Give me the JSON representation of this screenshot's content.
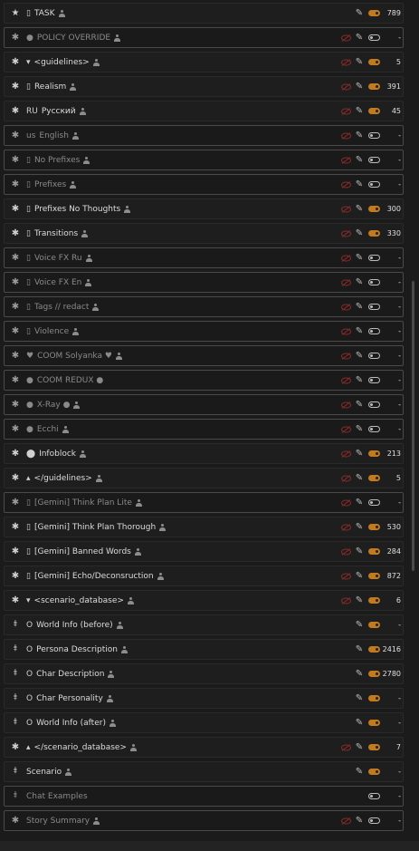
{
  "prompts": [
    {
      "icon": "star-pin",
      "glyph": "★",
      "label": "TASK",
      "prefix": "▯",
      "person": true,
      "noscan": false,
      "pencil": true,
      "toggle": "on",
      "tokens": "789",
      "disabled": false
    },
    {
      "icon": "asterisk",
      "glyph": "✱",
      "label": "POLICY OVERRIDE",
      "prefix": "●",
      "person": true,
      "noscan": true,
      "pencil": true,
      "toggle": "off",
      "tokens": "-",
      "disabled": true
    },
    {
      "icon": "asterisk",
      "glyph": "✱",
      "label": "<guidelines>",
      "prefix": "▾",
      "person": true,
      "noscan": true,
      "pencil": true,
      "toggle": "on",
      "tokens": "5",
      "disabled": false
    },
    {
      "icon": "asterisk",
      "glyph": "✱",
      "label": "Realism",
      "prefix": "▯",
      "person": true,
      "noscan": true,
      "pencil": true,
      "toggle": "on",
      "tokens": "391",
      "disabled": false
    },
    {
      "icon": "asterisk",
      "glyph": "✱",
      "label": "Русский",
      "prefix": "RU",
      "person": true,
      "noscan": true,
      "pencil": true,
      "toggle": "on",
      "tokens": "45",
      "disabled": false
    },
    {
      "icon": "asterisk",
      "glyph": "✱",
      "label": "English",
      "prefix": "us",
      "person": true,
      "noscan": true,
      "pencil": true,
      "toggle": "off",
      "tokens": "-",
      "disabled": true
    },
    {
      "icon": "asterisk",
      "glyph": "✱",
      "label": "No Prefixes",
      "prefix": "▯",
      "person": true,
      "noscan": true,
      "pencil": true,
      "toggle": "off",
      "tokens": "-",
      "disabled": true
    },
    {
      "icon": "asterisk",
      "glyph": "✱",
      "label": "Prefixes",
      "prefix": "▯",
      "person": true,
      "noscan": true,
      "pencil": true,
      "toggle": "off",
      "tokens": "-",
      "disabled": true
    },
    {
      "icon": "asterisk",
      "glyph": "✱",
      "label": "Prefixes No Thoughts",
      "prefix": "▯",
      "person": true,
      "noscan": true,
      "pencil": true,
      "toggle": "on",
      "tokens": "300",
      "disabled": false
    },
    {
      "icon": "asterisk",
      "glyph": "✱",
      "label": "Transitions",
      "prefix": "▯",
      "person": true,
      "noscan": true,
      "pencil": true,
      "toggle": "on",
      "tokens": "330",
      "disabled": false
    },
    {
      "icon": "asterisk",
      "glyph": "✱",
      "label": "Voice FX Ru",
      "prefix": "▯",
      "person": true,
      "noscan": true,
      "pencil": true,
      "toggle": "off",
      "tokens": "-",
      "disabled": true
    },
    {
      "icon": "asterisk",
      "glyph": "✱",
      "label": "Voice FX En",
      "prefix": "▯",
      "person": true,
      "noscan": true,
      "pencil": true,
      "toggle": "off",
      "tokens": "-",
      "disabled": true
    },
    {
      "icon": "asterisk",
      "glyph": "✱",
      "label": "Tags // redact",
      "prefix": "▯",
      "person": true,
      "noscan": true,
      "pencil": true,
      "toggle": "off",
      "tokens": "-",
      "disabled": true
    },
    {
      "icon": "asterisk",
      "glyph": "✱",
      "label": "Violence",
      "prefix": "▯",
      "person": true,
      "noscan": true,
      "pencil": true,
      "toggle": "off",
      "tokens": "-",
      "disabled": true
    },
    {
      "icon": "asterisk",
      "glyph": "✱",
      "label": "COOM Solyanka ♥",
      "prefix": "♥",
      "person": true,
      "noscan": true,
      "pencil": true,
      "toggle": "off",
      "tokens": "-",
      "disabled": true
    },
    {
      "icon": "asterisk",
      "glyph": "✱",
      "label": "COOM REDUX ●",
      "prefix": "●",
      "person": false,
      "noscan": true,
      "pencil": true,
      "toggle": "off",
      "tokens": "-",
      "disabled": true
    },
    {
      "icon": "asterisk",
      "glyph": "✱",
      "label": "X-Ray ●",
      "prefix": "●",
      "person": true,
      "noscan": true,
      "pencil": true,
      "toggle": "off",
      "tokens": "-",
      "disabled": true
    },
    {
      "icon": "asterisk",
      "glyph": "✱",
      "label": "Ecchi",
      "prefix": "●",
      "person": true,
      "noscan": true,
      "pencil": true,
      "toggle": "off",
      "tokens": "-",
      "disabled": true
    },
    {
      "icon": "asterisk",
      "glyph": "✱",
      "label": "Infoblock",
      "prefix": "⬤",
      "person": true,
      "noscan": true,
      "pencil": true,
      "toggle": "on",
      "tokens": "213",
      "disabled": false
    },
    {
      "icon": "asterisk",
      "glyph": "✱",
      "label": "</guidelines>",
      "prefix": "▴",
      "person": true,
      "noscan": true,
      "pencil": true,
      "toggle": "on",
      "tokens": "5",
      "disabled": false
    },
    {
      "icon": "asterisk",
      "glyph": "✱",
      "label": "[Gemini] Think Plan Lite",
      "prefix": "▯",
      "person": true,
      "noscan": true,
      "pencil": true,
      "toggle": "off",
      "tokens": "-",
      "disabled": true
    },
    {
      "icon": "asterisk",
      "glyph": "✱",
      "label": "[Gemini] Think Plan Thorough",
      "prefix": "▯",
      "person": true,
      "noscan": true,
      "pencil": true,
      "toggle": "on",
      "tokens": "530",
      "disabled": false
    },
    {
      "icon": "asterisk",
      "glyph": "✱",
      "label": "[Gemini] Banned Words",
      "prefix": "▯",
      "person": true,
      "noscan": true,
      "pencil": true,
      "toggle": "on",
      "tokens": "284",
      "disabled": false
    },
    {
      "icon": "asterisk",
      "glyph": "✱",
      "label": "[Gemini] Echo/Deconsruction",
      "prefix": "▯",
      "person": true,
      "noscan": true,
      "pencil": true,
      "toggle": "on",
      "tokens": "872",
      "disabled": false
    },
    {
      "icon": "asterisk",
      "glyph": "✱",
      "label": "<scenario_database>",
      "prefix": "▾",
      "person": true,
      "noscan": true,
      "pencil": true,
      "toggle": "on",
      "tokens": "6",
      "disabled": false
    },
    {
      "icon": "pin",
      "glyph": "⯒",
      "label": "World Info (before)",
      "prefix": "O",
      "person": true,
      "noscan": false,
      "pencil": true,
      "toggle": "on",
      "tokens": "-",
      "disabled": false
    },
    {
      "icon": "pin",
      "glyph": "⯒",
      "label": "Persona Description",
      "prefix": "O",
      "person": true,
      "noscan": false,
      "pencil": true,
      "toggle": "on",
      "tokens": "2416",
      "disabled": false
    },
    {
      "icon": "pin",
      "glyph": "⯒",
      "label": "Char Description",
      "prefix": "O",
      "person": true,
      "noscan": false,
      "pencil": true,
      "toggle": "on",
      "tokens": "2780",
      "disabled": false
    },
    {
      "icon": "pin",
      "glyph": "⯒",
      "label": "Char Personality",
      "prefix": "O",
      "person": true,
      "noscan": false,
      "pencil": true,
      "toggle": "on",
      "tokens": "-",
      "disabled": false
    },
    {
      "icon": "pin",
      "glyph": "⯒",
      "label": "World Info (after)",
      "prefix": "O",
      "person": true,
      "noscan": false,
      "pencil": true,
      "toggle": "on",
      "tokens": "-",
      "disabled": false
    },
    {
      "icon": "asterisk",
      "glyph": "✱",
      "label": "</scenario_database>",
      "prefix": "▴",
      "person": true,
      "noscan": true,
      "pencil": true,
      "toggle": "on",
      "tokens": "7",
      "disabled": false
    },
    {
      "icon": "pin",
      "glyph": "⯒",
      "label": "Scenario",
      "prefix": "",
      "person": true,
      "noscan": false,
      "pencil": true,
      "toggle": "on",
      "tokens": "-",
      "disabled": false
    },
    {
      "icon": "pin",
      "glyph": "⯒",
      "label": "Chat Examples",
      "prefix": "",
      "person": false,
      "noscan": false,
      "pencil": false,
      "toggle": "off",
      "tokens": "-",
      "disabled": true
    },
    {
      "icon": "asterisk",
      "glyph": "✱",
      "label": "Story Summary",
      "prefix": "",
      "person": true,
      "noscan": true,
      "pencil": true,
      "toggle": "off",
      "tokens": "-",
      "disabled": true
    }
  ],
  "colors": {
    "accent": "#c27a21",
    "noscan": "#8a2a2a",
    "bg": "#1b1b1b"
  }
}
